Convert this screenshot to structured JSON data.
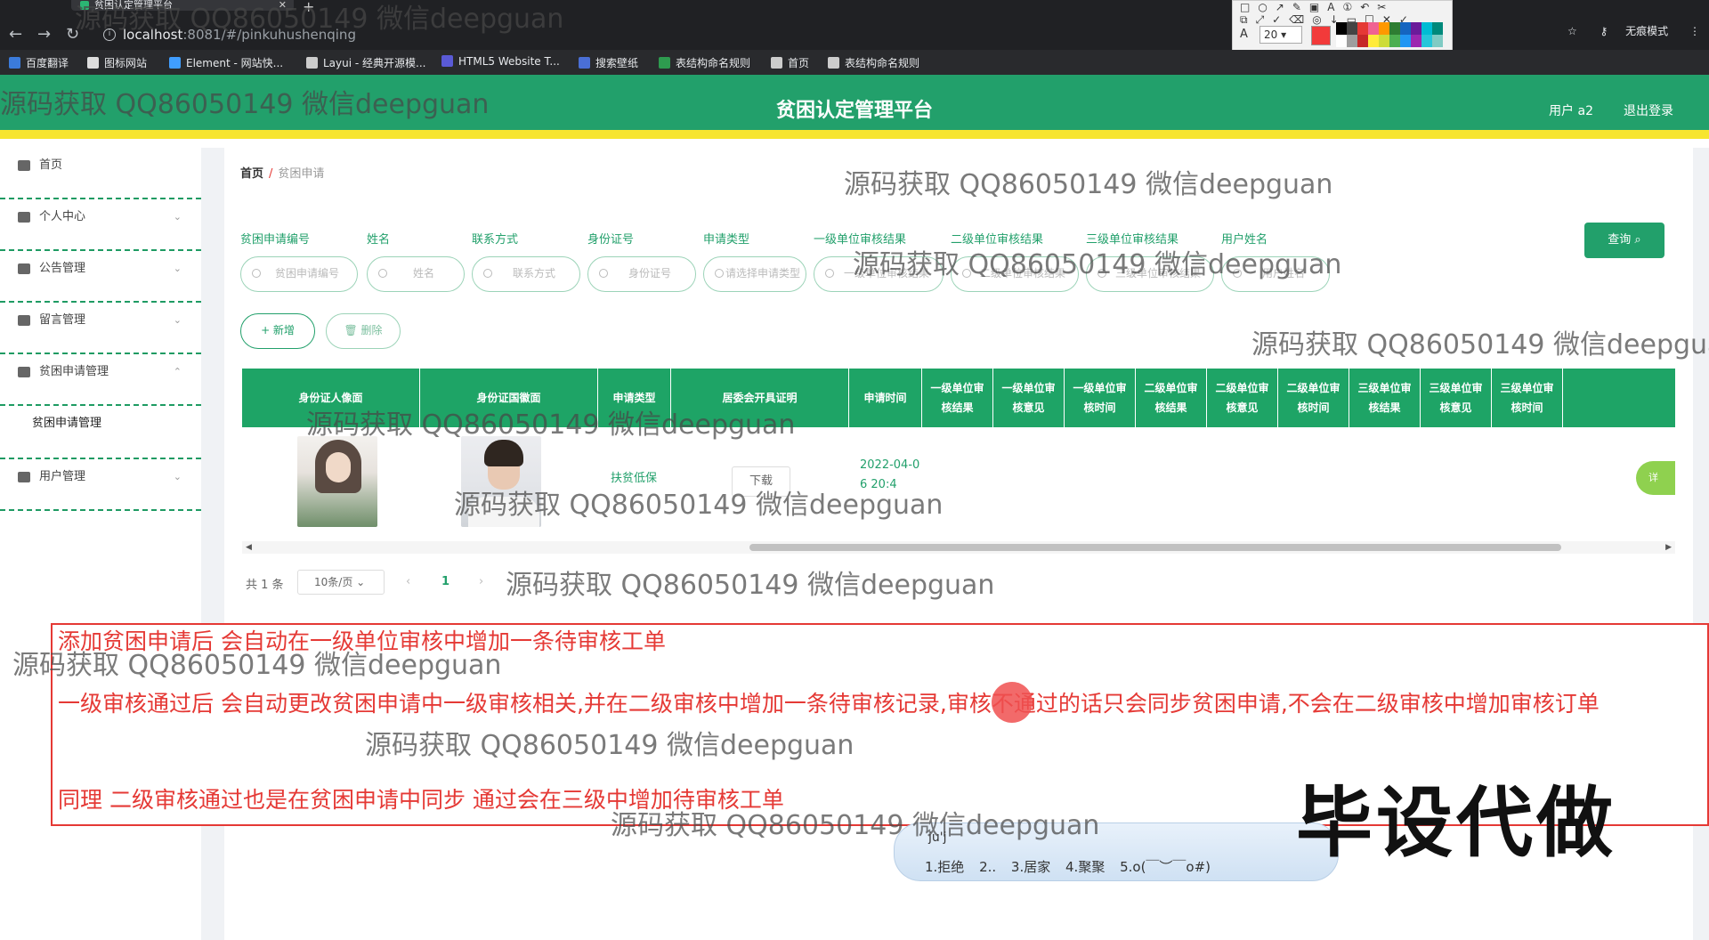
{
  "browser": {
    "tab_title": "贫困认定管理平台",
    "url_host": "localhost",
    "url_path": ":8081/#/pinkuhushenqing",
    "incognito_label": "无痕模式",
    "bookmarks": [
      {
        "label": "百度翻译",
        "color": "#3b7bdb"
      },
      {
        "label": "图标网站",
        "color": "#dddddd"
      },
      {
        "label": "Element - 网站快...",
        "color": "#409eff"
      },
      {
        "label": "Layui - 经典开源模...",
        "color": "#cccccc"
      },
      {
        "label": "HTML5 Website T...",
        "color": "#5a5ad6"
      },
      {
        "label": "搜索壁纸",
        "color": "#4a6fd6"
      },
      {
        "label": "表结构命名规则",
        "color": "#2e9b4f"
      },
      {
        "label": "首页",
        "color": "#cccccc"
      },
      {
        "label": "表结构命名规则",
        "color": "#cccccc"
      }
    ]
  },
  "annotation_toolbar": {
    "font_label": "A",
    "font_size": "20",
    "current_color": "#f23a3a",
    "swatches": [
      "#000000",
      "#444444",
      "#e53935",
      "#f06292",
      "#ff9800",
      "#2e7d32",
      "#1565c0",
      "#6a1b9a",
      "#00bcd4",
      "#00897b",
      "#ffffff",
      "#9e9e9e",
      "#c62828",
      "#ffeb3b",
      "#cddc39",
      "#4caf50",
      "#2196f3",
      "#9c27b0",
      "#26c6da",
      "#80cbc4"
    ]
  },
  "header": {
    "title": "贫困认定管理平台",
    "user": "用户 a2",
    "logout": "退出登录",
    "accent": "#22a06b"
  },
  "sidebar": {
    "items": [
      {
        "label": "首页",
        "icon": "home-icon"
      },
      {
        "label": "个人中心",
        "icon": "user-icon"
      },
      {
        "label": "公告管理",
        "icon": "notice-icon"
      },
      {
        "label": "留言管理",
        "icon": "message-icon"
      },
      {
        "label": "贫困申请管理",
        "icon": "grid-icon",
        "expanded": true
      },
      {
        "label": "用户管理",
        "icon": "doc-icon"
      }
    ],
    "subitem": "贫困申请管理"
  },
  "breadcrumb": {
    "home": "首页",
    "separator": "/",
    "current": "贫困申请"
  },
  "filters": [
    {
      "label": "贫困申请编号",
      "placeholder": "贫困申请编号"
    },
    {
      "label": "姓名",
      "placeholder": "姓名"
    },
    {
      "label": "联系方式",
      "placeholder": "联系方式"
    },
    {
      "label": "身份证号",
      "placeholder": "身份证号"
    },
    {
      "label": "申请类型",
      "placeholder": "请选择申请类型"
    },
    {
      "label": "一级单位审核结果",
      "placeholder": "一级单位审核结果"
    },
    {
      "label": "二级单位审核结果",
      "placeholder": "二级单位审核结果"
    },
    {
      "label": "三级单位审核结果",
      "placeholder": "三级单位审核结果"
    },
    {
      "label": "用户姓名",
      "placeholder": "用户姓名"
    }
  ],
  "buttons": {
    "query": "查询",
    "add": "+ 新增",
    "delete": "删除"
  },
  "table": {
    "headers": [
      "身份证人像面",
      "身份证国徽面",
      "申请类型",
      "居委会开具证明",
      "申请时间",
      "一级单位审核结果",
      "一级单位审核意见",
      "一级单位审核时间",
      "二级单位审核结果",
      "二级单位审核意见",
      "二级单位审核时间",
      "三级单位审核结果",
      "三级单位审核意见",
      "三级单位审核时间"
    ],
    "rows": [
      {
        "type": "扶贫低保",
        "certificate_button": "下载",
        "time": "2022-04-06 20:4",
        "action": "详"
      }
    ]
  },
  "pagination": {
    "total": "共 1 条",
    "page_size": "10条/页",
    "current_page": "1"
  },
  "notes": [
    "添加贫困申请后 会自动在一级单位审核中增加一条待审核工单",
    "一级审核通过后 会自动更改贫困申请中一级审核相关,并在二级审核中增加一条待审核记录,审核不通过的话只会同步贫困申请,不会在二级审核中增加审核订单",
    "同理 二级审核通过也是在贫困申请中同步 通过会在三级中增加待审核工单"
  ],
  "ime": {
    "composition": "ju'j",
    "candidates": "1.拒绝 2.. 3.居家 4.聚聚 5.o(￣︶￣o#)"
  },
  "watermark": "源码获取 QQ86050149 微信deepguan",
  "promo_text": "毕设代做"
}
